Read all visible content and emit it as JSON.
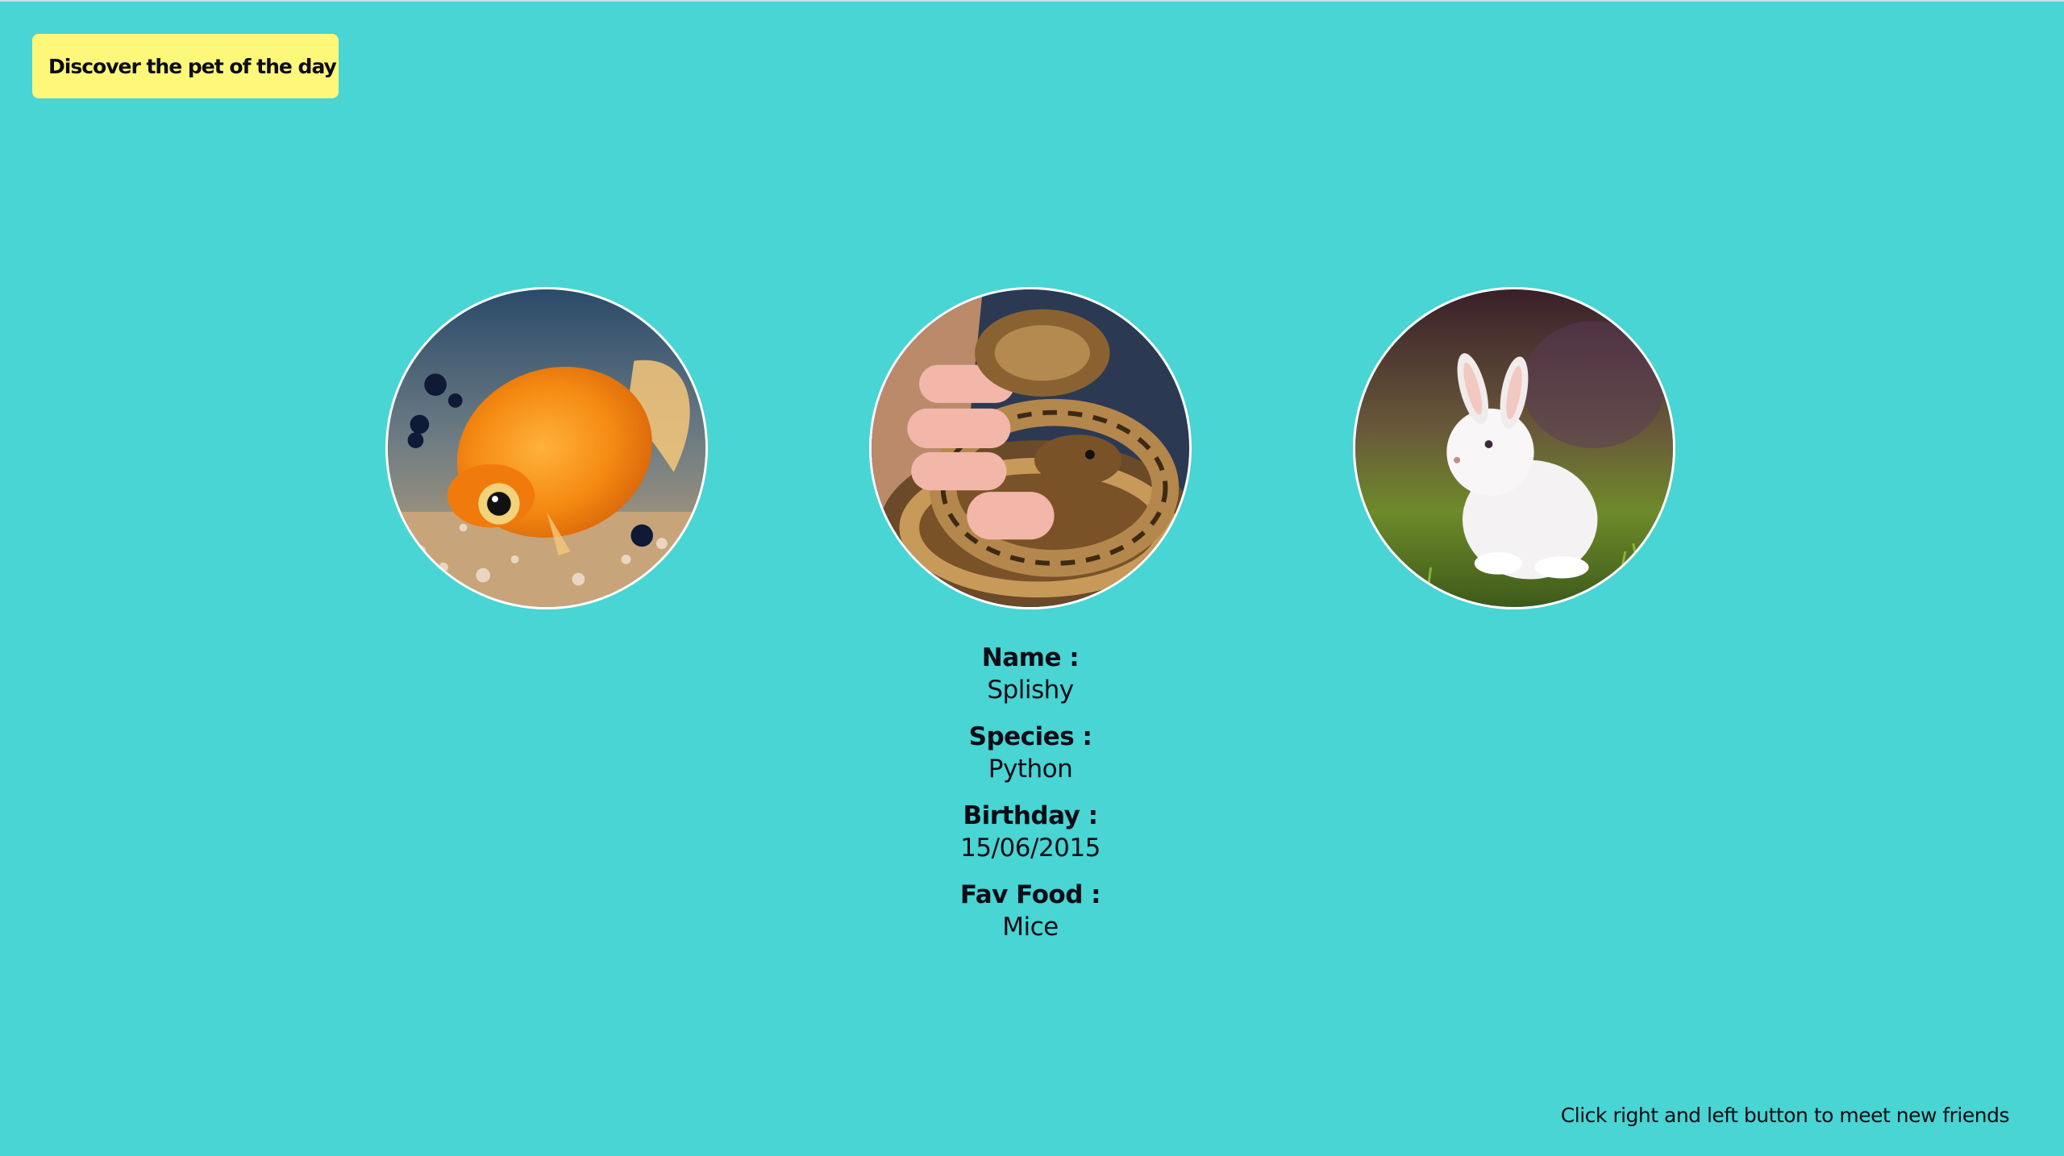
{
  "header": {
    "discover_button_label": "Discover the pet of the day"
  },
  "carousel": {
    "pets": [
      {
        "image_icon": "goldfish-photo"
      },
      {
        "image_icon": "python-snake-photo"
      },
      {
        "image_icon": "white-rabbit-photo"
      }
    ]
  },
  "pet_info": {
    "name_label": "Name :",
    "name_value": "Splishy",
    "species_label": "Species :",
    "species_value": "Python",
    "birthday_label": "Birthday :",
    "birthday_value": "15/06/2015",
    "food_label": "Fav Food :",
    "food_value": "Mice"
  },
  "footer": {
    "hint_text": "Click right and left button to meet new friends"
  },
  "colors": {
    "background": "#48d5d3",
    "button": "#fdf77a",
    "text": "#0c0c16"
  }
}
